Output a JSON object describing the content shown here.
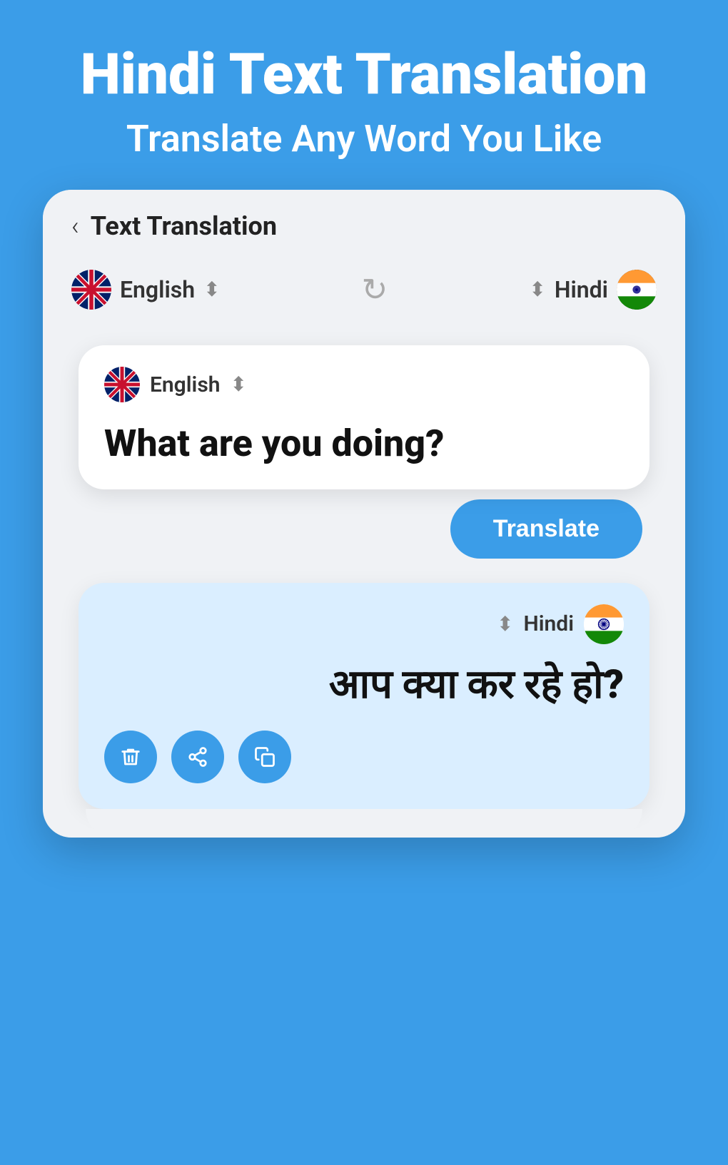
{
  "header": {
    "title": "Hindi Text Translation",
    "subtitle": "Translate Any Word You Like"
  },
  "app": {
    "back_label": "‹",
    "screen_title": "Text Translation",
    "source_lang": "English",
    "target_lang": "Hindi",
    "swap_icon": "⟳",
    "input_text": "What are you doing?",
    "output_text": "आप क्या कर रहे हो?",
    "translate_button": "Translate",
    "sort_arrows": "⬍",
    "delete_icon": "🗑",
    "share_icon": "⋮",
    "copy_icon": "⧉"
  }
}
